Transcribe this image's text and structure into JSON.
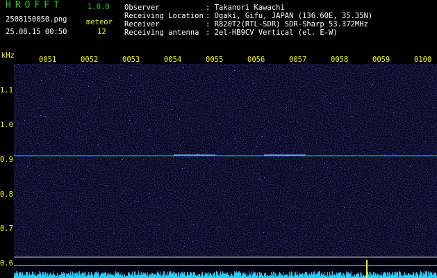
{
  "app": {
    "title": "HROFFT",
    "version": "1.0.0"
  },
  "file": {
    "name": "2508150050.png",
    "datetime": "25.08.15 00:50"
  },
  "counter": {
    "label": "meteor",
    "value": "12"
  },
  "station": {
    "rows": [
      {
        "label": "Observer",
        "value": ": Takanori Kawachi"
      },
      {
        "label": "Receiving Location",
        "value": ": Ogaki, Gifu, JAPAN (136.60E, 35.35N)"
      },
      {
        "label": "Receiver",
        "value": ": R820T2(RTL-SDR) SDR-Sharp 53.372MHz"
      },
      {
        "label": "Receiving antenna",
        "value": ": 2el-HB9CV Vertical (el. E-W)"
      }
    ]
  },
  "time_axis": {
    "ticks": [
      "0051",
      "0052",
      "0053",
      "0054",
      "0055",
      "0056",
      "0057",
      "0058",
      "0059",
      "0100"
    ]
  },
  "freq_axis": {
    "unit": "kHz",
    "ticks": [
      "1.1",
      "1.0",
      "0.9",
      "0.8",
      "0.7",
      "0.6"
    ]
  },
  "colors": {
    "background": "#000000",
    "noise": "#1a1a8c",
    "echo_line": "#4aa0ff",
    "spectrum": "#20d0ff",
    "axis_text": "#f6f61e",
    "title_text": "#1fd11f"
  },
  "icons": {
    "spectrogram": "spectrogram-image"
  }
}
